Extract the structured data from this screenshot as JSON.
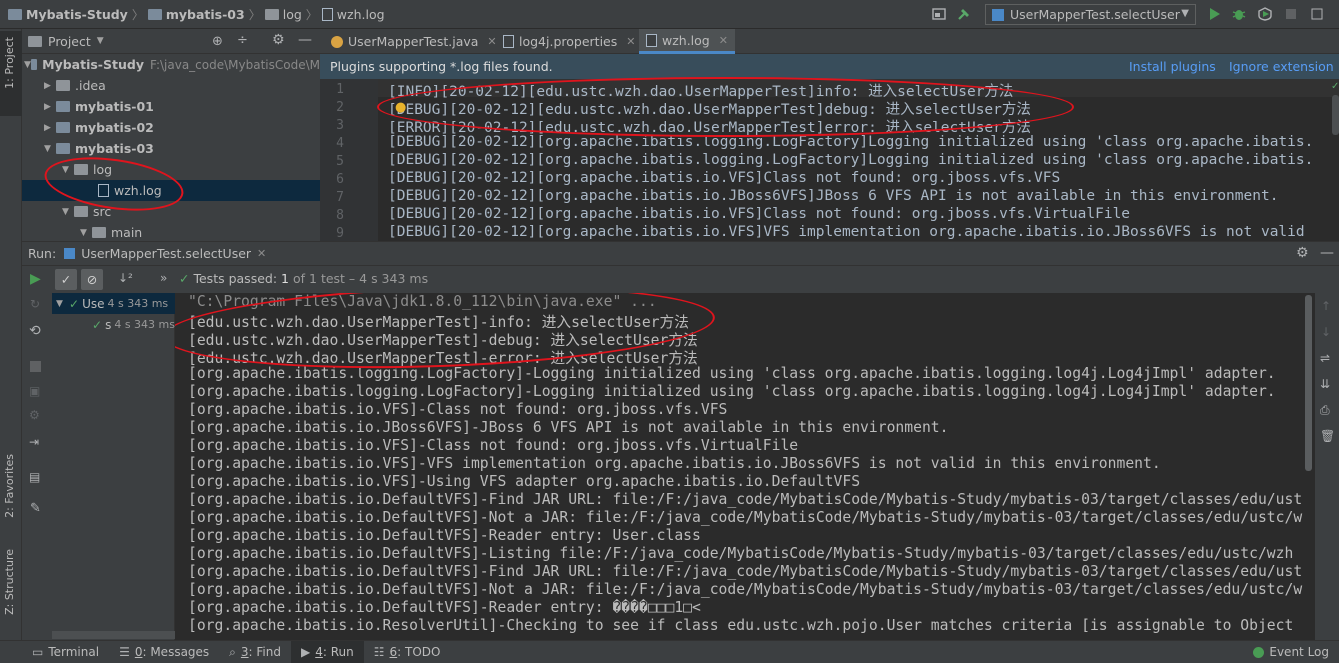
{
  "breadcrumb": [
    "Mybatis-Study",
    "mybatis-03",
    "log",
    "wzh.log"
  ],
  "run_config": "UserMapperTest.selectUser",
  "left_stripe": {
    "project_tab": "1: Project",
    "favorites_tab": "2: Favorites",
    "structure_tab": "Z: Structure"
  },
  "project_panel": {
    "title": "Project",
    "tree": [
      {
        "label": "Mybatis-Study",
        "hint": "F:\\java_code\\MybatisCode\\M"
      },
      {
        "label": ".idea"
      },
      {
        "label": "mybatis-01"
      },
      {
        "label": "mybatis-02"
      },
      {
        "label": "mybatis-03"
      },
      {
        "label": "log"
      },
      {
        "label": "wzh.log"
      },
      {
        "label": "src"
      },
      {
        "label": "main"
      }
    ]
  },
  "editor": {
    "tabs": [
      "UserMapperTest.java",
      "log4j.properties",
      "wzh.log"
    ],
    "banner": {
      "text": "Plugins supporting *.log files found.",
      "install": "Install plugins",
      "ignore": "Ignore extension"
    },
    "line_numbers": [
      "1",
      "2",
      "3",
      "4",
      "5",
      "6",
      "7",
      "8",
      "9"
    ],
    "lines": [
      "[INFO][20-02-12][edu.ustc.wzh.dao.UserMapperTest]info: 进入selectUser方法",
      "[DEBUG][20-02-12][edu.ustc.wzh.dao.UserMapperTest]debug: 进入selectUser方法",
      "[ERROR][20-02-12][edu.ustc.wzh.dao.UserMapperTest]error: 进入selectUser方法",
      "[DEBUG][20-02-12][org.apache.ibatis.logging.LogFactory]Logging initialized using 'class org.apache.ibatis.",
      "[DEBUG][20-02-12][org.apache.ibatis.logging.LogFactory]Logging initialized using 'class org.apache.ibatis.",
      "[DEBUG][20-02-12][org.apache.ibatis.io.VFS]Class not found: org.jboss.vfs.VFS",
      "[DEBUG][20-02-12][org.apache.ibatis.io.JBoss6VFS]JBoss 6 VFS API is not available in this environment.",
      "[DEBUG][20-02-12][org.apache.ibatis.io.VFS]Class not found: org.jboss.vfs.VirtualFile",
      "[DEBUG][20-02-12][org.apache.ibatis.io.VFS]VFS implementation org.apache.ibatis.io.JBoss6VFS is not valid"
    ]
  },
  "run": {
    "label": "Run:",
    "config_tab": "UserMapperTest.selectUser",
    "tests_passed_label": "Tests passed:",
    "tests_passed_count": "1",
    "tests_passed_rest": "of 1 test – 4 s 343 ms",
    "tree": [
      {
        "label": "Use",
        "time": "4 s 343 ms"
      },
      {
        "label": "s",
        "time": "4 s 343 ms"
      }
    ],
    "console": [
      "\"C:\\Program Files\\Java\\jdk1.8.0_112\\bin\\java.exe\" ...",
      "[edu.ustc.wzh.dao.UserMapperTest]-info: 进入selectUser方法",
      "[edu.ustc.wzh.dao.UserMapperTest]-debug: 进入selectUser方法",
      "[edu.ustc.wzh.dao.UserMapperTest]-error: 进入selectUser方法",
      "[org.apache.ibatis.logging.LogFactory]-Logging initialized using 'class org.apache.ibatis.logging.log4j.Log4jImpl' adapter.",
      "[org.apache.ibatis.logging.LogFactory]-Logging initialized using 'class org.apache.ibatis.logging.log4j.Log4jImpl' adapter.",
      "[org.apache.ibatis.io.VFS]-Class not found: org.jboss.vfs.VFS",
      "[org.apache.ibatis.io.JBoss6VFS]-JBoss 6 VFS API is not available in this environment.",
      "[org.apache.ibatis.io.VFS]-Class not found: org.jboss.vfs.VirtualFile",
      "[org.apache.ibatis.io.VFS]-VFS implementation org.apache.ibatis.io.JBoss6VFS is not valid in this environment.",
      "[org.apache.ibatis.io.VFS]-Using VFS adapter org.apache.ibatis.io.DefaultVFS",
      "[org.apache.ibatis.io.DefaultVFS]-Find JAR URL: file:/F:/java_code/MybatisCode/Mybatis-Study/mybatis-03/target/classes/edu/ust",
      "[org.apache.ibatis.io.DefaultVFS]-Not a JAR: file:/F:/java_code/MybatisCode/Mybatis-Study/mybatis-03/target/classes/edu/ustc/w",
      "[org.apache.ibatis.io.DefaultVFS]-Reader entry: User.class",
      "[org.apache.ibatis.io.DefaultVFS]-Listing file:/F:/java_code/MybatisCode/Mybatis-Study/mybatis-03/target/classes/edu/ustc/wzh",
      "[org.apache.ibatis.io.DefaultVFS]-Find JAR URL: file:/F:/java_code/MybatisCode/Mybatis-Study/mybatis-03/target/classes/edu/ust",
      "[org.apache.ibatis.io.DefaultVFS]-Not a JAR: file:/F:/java_code/MybatisCode/Mybatis-Study/mybatis-03/target/classes/edu/ustc/w",
      "[org.apache.ibatis.io.DefaultVFS]-Reader entry: ����□□□1□<",
      "[org.apache.ibatis.io.ResolverUtil]-Checking to see if class edu.ustc.wzh.pojo.User matches criteria [is assignable to Object"
    ]
  },
  "bottom_tabs": [
    {
      "num": "",
      "label": "Terminal"
    },
    {
      "num": "0",
      "label": ": Messages"
    },
    {
      "num": "3",
      "label": ": Find"
    },
    {
      "num": "4",
      "label": ": Run"
    },
    {
      "num": "6",
      "label": ": TODO"
    }
  ],
  "event_log": "Event Log",
  "colors": {
    "accent": "#4a88c7",
    "annotation": "#e0141d",
    "pass": "#59a869",
    "link": "#589df6"
  }
}
